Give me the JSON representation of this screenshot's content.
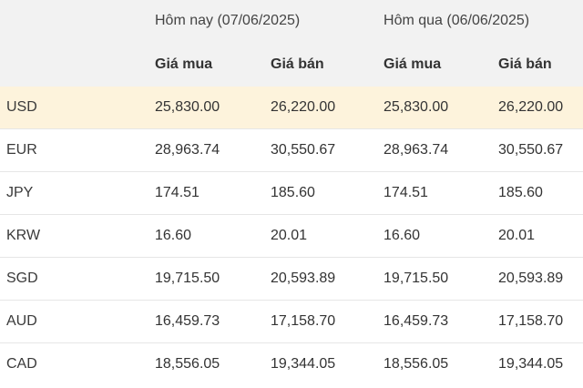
{
  "header": {
    "today_label": "Hôm nay (07/06/2025)",
    "yesterday_label": "Hôm qua (06/06/2025)",
    "buy_label": "Giá mua",
    "sell_label": "Giá bán"
  },
  "highlight_color": "#fdf3dc",
  "header_bg_color": "#f2f2f2",
  "rows": [
    {
      "code": "USD",
      "today_buy": "25,830.00",
      "today_sell": "26,220.00",
      "yesterday_buy": "25,830.00",
      "yesterday_sell": "26,220.00"
    },
    {
      "code": "EUR",
      "today_buy": "28,963.74",
      "today_sell": "30,550.67",
      "yesterday_buy": "28,963.74",
      "yesterday_sell": "30,550.67"
    },
    {
      "code": "JPY",
      "today_buy": "174.51",
      "today_sell": "185.60",
      "yesterday_buy": "174.51",
      "yesterday_sell": "185.60"
    },
    {
      "code": "KRW",
      "today_buy": "16.60",
      "today_sell": "20.01",
      "yesterday_buy": "16.60",
      "yesterday_sell": "20.01"
    },
    {
      "code": "SGD",
      "today_buy": "19,715.50",
      "today_sell": "20,593.89",
      "yesterday_buy": "19,715.50",
      "yesterday_sell": "20,593.89"
    },
    {
      "code": "AUD",
      "today_buy": "16,459.73",
      "today_sell": "17,158.70",
      "yesterday_buy": "16,459.73",
      "yesterday_sell": "17,158.70"
    },
    {
      "code": "CAD",
      "today_buy": "18,556.05",
      "today_sell": "19,344.05",
      "yesterday_buy": "18,556.05",
      "yesterday_sell": "19,344.05"
    }
  ]
}
